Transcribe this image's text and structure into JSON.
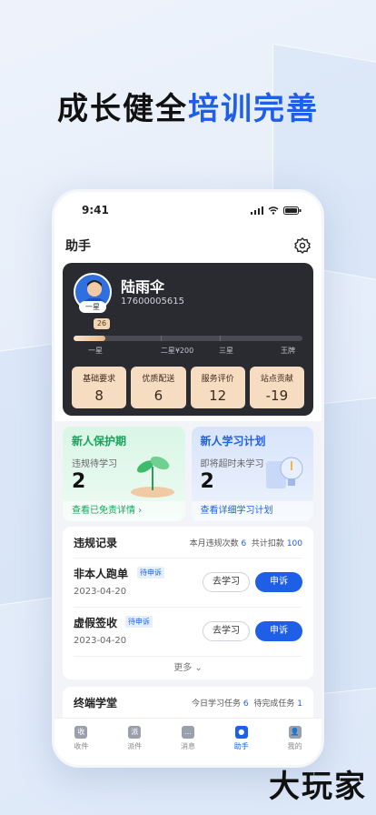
{
  "headline": {
    "part1": "成长健全",
    "part2": "培训完善"
  },
  "status": {
    "time": "9:41"
  },
  "app": {
    "title": "助手"
  },
  "profile": {
    "name": "陆雨伞",
    "phone": "17600005615",
    "badge": "一星",
    "level": "26",
    "progress": 0.14,
    "ticks": [
      "一星",
      "二星¥200",
      "三星",
      "王牌"
    ],
    "stats": [
      {
        "label": "基础要求",
        "value": "8"
      },
      {
        "label": "优质配送",
        "value": "6"
      },
      {
        "label": "服务评价",
        "value": "12"
      },
      {
        "label": "站点贡献",
        "value": "-19"
      }
    ]
  },
  "promo": {
    "left": {
      "title": "新人保护期",
      "sub": "违规待学习",
      "num": "2",
      "link": "查看已免责详情 ›"
    },
    "right": {
      "title": "新人学习计划",
      "sub": "即将超时未学习",
      "num": "2",
      "link": "查看详细学习计划"
    }
  },
  "violations": {
    "title": "违规记录",
    "meta_count_label": "本月违规次数",
    "meta_count": "6",
    "meta_points_label": "共计扣款",
    "meta_points": "100",
    "records": [
      {
        "title": "非本人跑单",
        "tag": "待申诉",
        "date": "2023-04-20",
        "learn": "去学习",
        "appeal": "申诉"
      },
      {
        "title": "虚假签收",
        "tag": "待申诉",
        "date": "2023-04-20",
        "learn": "去学习",
        "appeal": "申诉"
      }
    ],
    "more": "更多 ⌄"
  },
  "school": {
    "title": "终端学堂",
    "today_label": "今日学习任务",
    "today": "6",
    "todo_label": "待完成任务",
    "todo": "1"
  },
  "tabs": [
    {
      "icon": "收",
      "label": "收件"
    },
    {
      "icon": "派",
      "label": "派件"
    },
    {
      "icon": "…",
      "label": "消息"
    },
    {
      "icon": "●",
      "label": "助手"
    },
    {
      "icon": "👤",
      "label": "我的"
    }
  ],
  "watermark": "大玩家",
  "colors": {
    "accent": "#1f5fe8",
    "green": "#17a35d",
    "card_dark": "#2a2b31",
    "stat_bg": "#f6dcc0"
  }
}
